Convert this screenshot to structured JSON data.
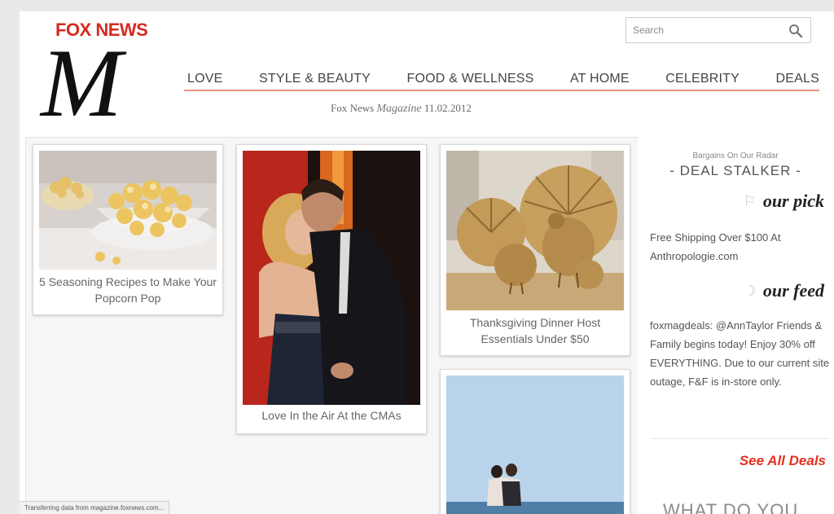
{
  "header": {
    "brand": "FOX NEWS",
    "logo_letter": "M",
    "search": {
      "placeholder": "Search",
      "value": ""
    },
    "nav": [
      {
        "label": "LOVE"
      },
      {
        "label": "STYLE & BEAUTY"
      },
      {
        "label": "FOOD & WELLNESS"
      },
      {
        "label": "AT HOME"
      },
      {
        "label": "CELEBRITY"
      },
      {
        "label": "DEALS"
      }
    ],
    "dateline": {
      "prefix": "Fox News",
      "magazine": "Magazine",
      "date": "11.02.2012"
    }
  },
  "cards": [
    {
      "caption": "5 Seasoning Recipes to Make Your Popcorn Pop",
      "image": "popcorn-bowl"
    },
    {
      "caption": "Love In the Air At the CMAs",
      "image": "couple-embrace"
    },
    {
      "caption": "Thanksgiving Dinner Host Essentials Under $50",
      "image": "straw-turkeys"
    },
    {
      "caption": "",
      "image": "beach-couple"
    }
  ],
  "sidebar": {
    "kicker": "Bargains On Our Radar",
    "title": "- DEAL STALKER -",
    "pick_heading": "our pick",
    "pick_text": "Free Shipping Over $100 At Anthropologie.com",
    "feed_heading": "our feed",
    "feed_text": "foxmagdeals: @AnnTaylor Friends & Family begins today! Enjoy 30% off EVERYTHING. Due to our current site outage, F&F is in-store only.",
    "see_all": "See All Deals",
    "teaser": "WHAT DO YOU"
  },
  "status_bar": "Transferring data from magazine.foxnews.com...",
  "colors": {
    "brand_red": "#d42a20",
    "nav_rule": "#e99588",
    "link_red": "#e2311e"
  }
}
